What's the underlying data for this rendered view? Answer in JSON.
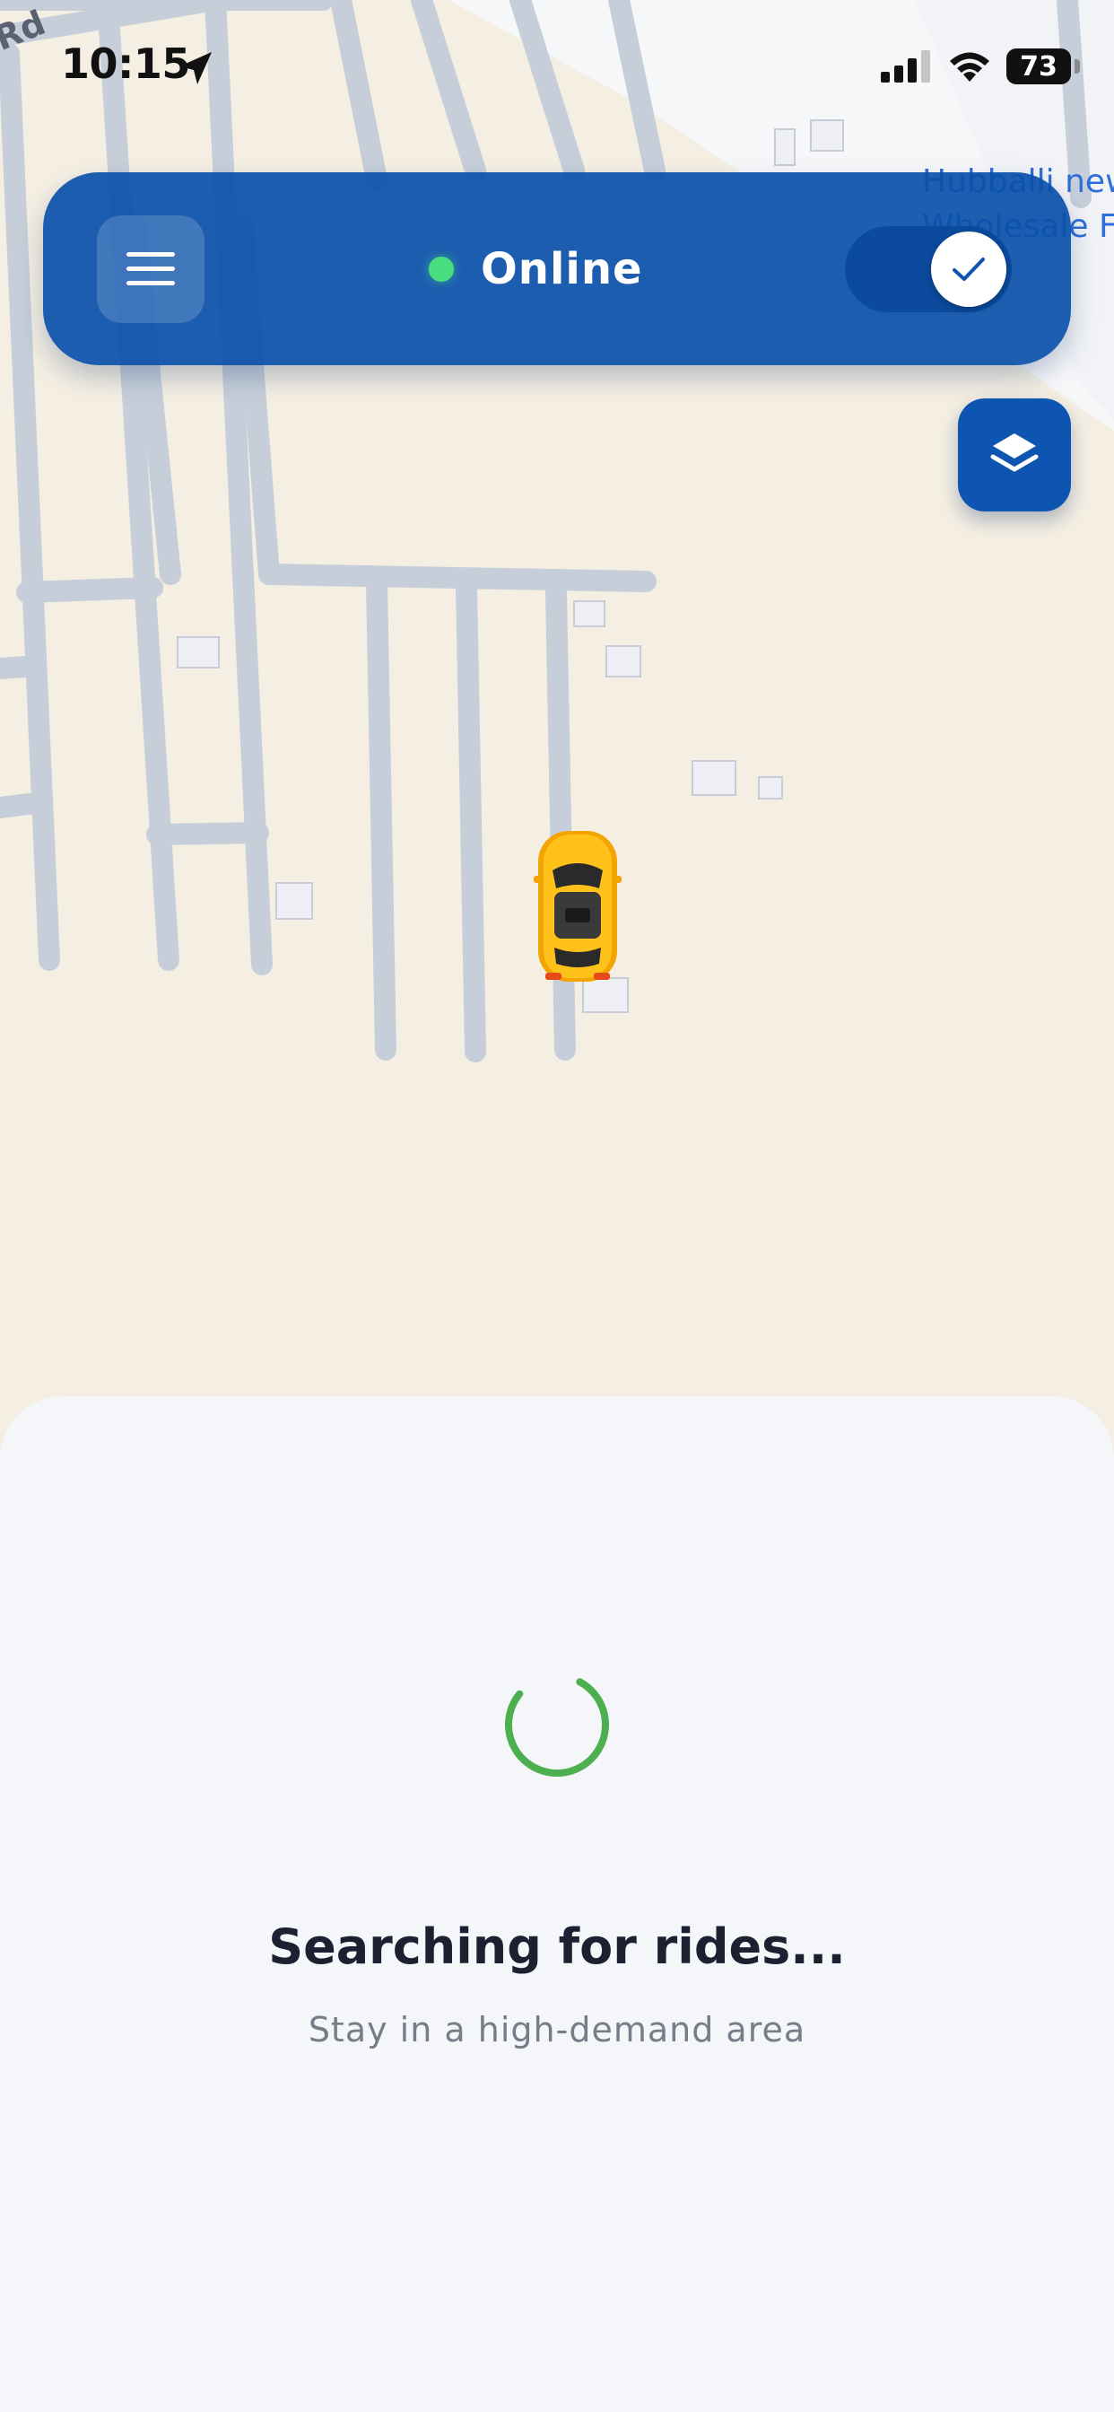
{
  "status_bar": {
    "time": "10:15",
    "battery": "73",
    "location_icon": "location-arrow-icon",
    "signal_icon": "cellular-signal-icon",
    "wifi_icon": "wifi-icon"
  },
  "map": {
    "road_label": "Rd",
    "place_label_line1": "Hubballi new",
    "place_label_line2": "Wholesale F",
    "vehicle_icon": "taxi-car-icon"
  },
  "header": {
    "menu_icon": "hamburger-menu-icon",
    "status_label": "Online",
    "status_color": "#4ade80",
    "toggle_on": true,
    "toggle_icon": "checkmark-icon"
  },
  "layers_button": {
    "icon": "layers-icon"
  },
  "bottom_sheet": {
    "title": "Searching for rides...",
    "subtitle": "Stay in a high-demand area",
    "spinner_color": "#4caf50"
  },
  "colors": {
    "primary": "#0d55b0",
    "map_background": "#f5efe3",
    "roads": "#c6cfd9"
  }
}
